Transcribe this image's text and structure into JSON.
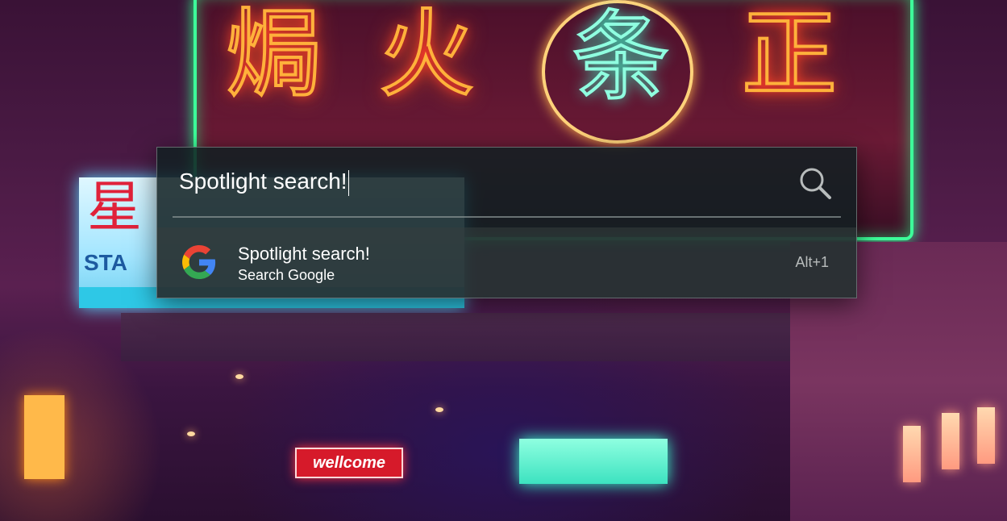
{
  "background": {
    "description_icon": "neon-street-wallpaper",
    "sign_wellcome": "wellcome"
  },
  "spotlight": {
    "query": "Spotlight search!",
    "search_icon": "search-icon",
    "results": [
      {
        "icon": "google-icon",
        "title": "Spotlight search!",
        "subtitle": "Search Google",
        "shortcut": "Alt+1"
      }
    ]
  },
  "colors": {
    "panel_bg": "#122022",
    "text": "#ffffff",
    "shortcut_text": "#b8bcbc",
    "google_blue": "#4285F4",
    "google_red": "#EA4335",
    "google_yellow": "#FBBC05",
    "google_green": "#34A853"
  }
}
